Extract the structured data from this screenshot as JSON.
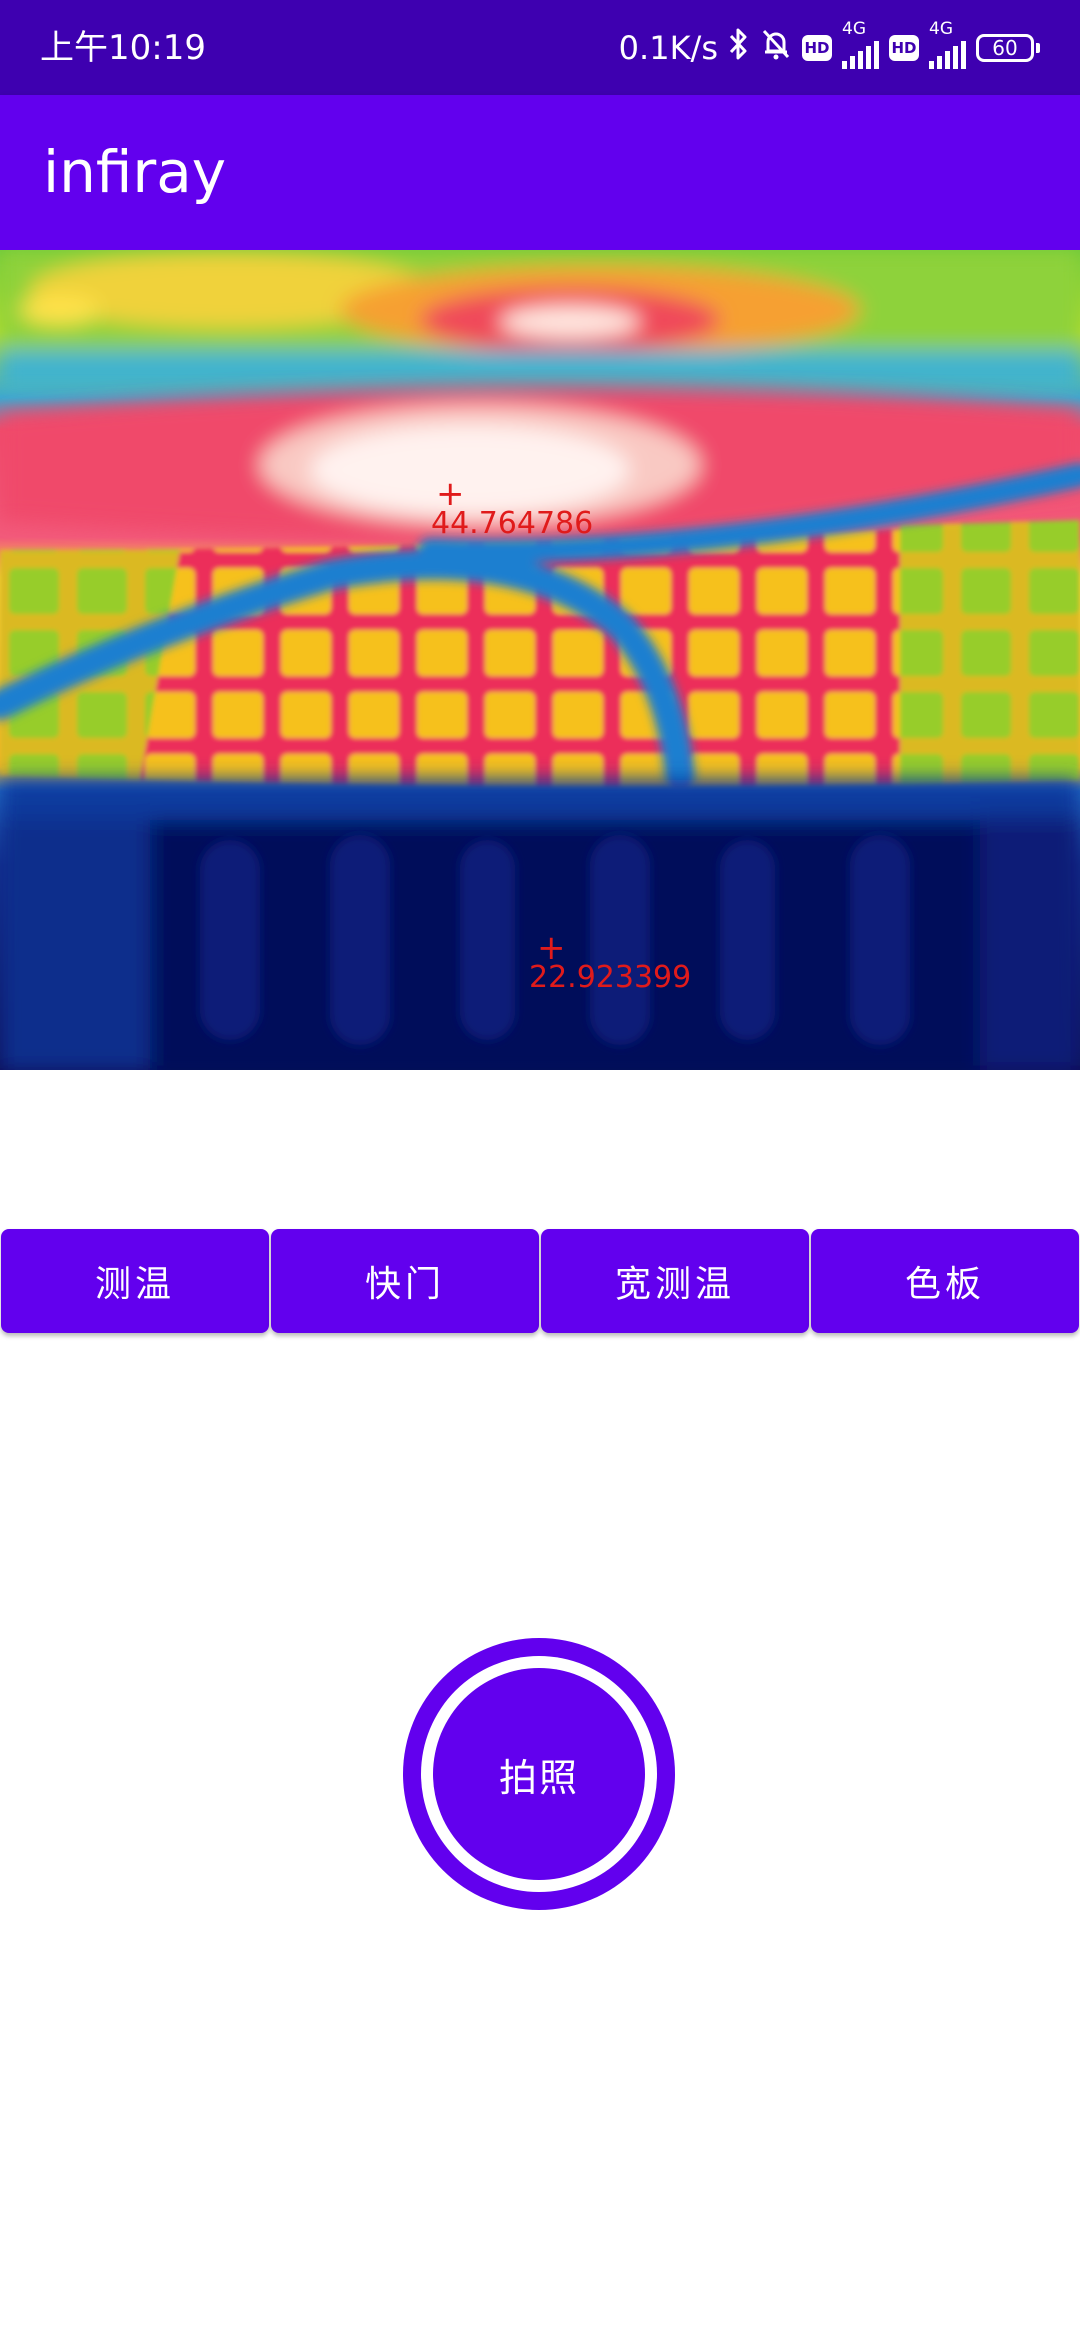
{
  "status_bar": {
    "time": "上午10:19",
    "net_speed": "0.1K/s",
    "icons": [
      "bluetooth-icon",
      "mute-bell-icon",
      "hd-icon",
      "signal-4g-icon",
      "hd-icon",
      "signal-4g-icon",
      "battery-icon"
    ],
    "hd_label": "HD",
    "network_label": "4G",
    "battery": "60"
  },
  "app_bar": {
    "title": "infiray"
  },
  "thermal_view": {
    "palette": "iron-rainbow",
    "markers": [
      {
        "id": "max",
        "plus": "+",
        "value": "44.764786"
      },
      {
        "id": "min",
        "plus": "+",
        "value": "22.923399"
      }
    ]
  },
  "actions": {
    "measure_label": "测温",
    "shutter_label": "快门",
    "wide_measure_label": "宽测温",
    "palette_label": "色板"
  },
  "capture": {
    "label": "拍照"
  },
  "colors": {
    "status_bar": "#3e00b0",
    "primary": "#6200ee",
    "marker": "#e01b1b"
  }
}
